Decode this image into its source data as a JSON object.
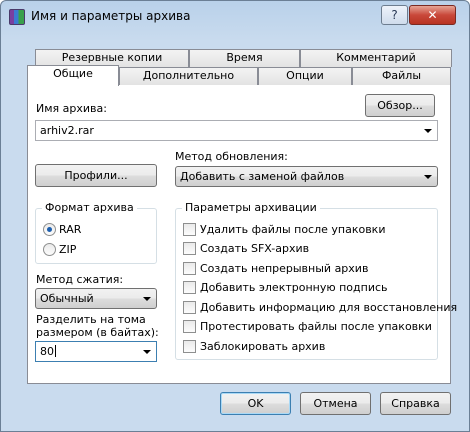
{
  "window": {
    "title": "Имя и параметры архива",
    "help_label": "?",
    "close_label": "✕"
  },
  "tabs": {
    "row_back": [
      "Резервные копии",
      "Время",
      "Комментарий"
    ],
    "row_front": [
      "Общие",
      "Дополнительно",
      "Опции",
      "Файлы"
    ],
    "active": "Общие"
  },
  "general": {
    "archive_name_label": "Имя архива:",
    "archive_name_value": "arhiv2.rar",
    "browse_label": "Обзор...",
    "profiles_label": "Профили...",
    "update_method_label": "Метод обновления:",
    "update_method_value": "Добавить с заменой файлов",
    "format": {
      "title": "Формат архива",
      "options": [
        "RAR",
        "ZIP"
      ],
      "selected": "RAR"
    },
    "compression_label": "Метод сжатия:",
    "compression_value": "Обычный",
    "split_label_line1": "Разделить на тома",
    "split_label_line2": "размером (в байтах):",
    "split_value": "80",
    "params": {
      "title": "Параметры архивации",
      "options": [
        {
          "label": "Удалить файлы после упаковки",
          "checked": false
        },
        {
          "label": "Создать SFX-архив",
          "checked": false
        },
        {
          "label": "Создать непрерывный архив",
          "checked": false
        },
        {
          "label": "Добавить электронную подпись",
          "checked": false
        },
        {
          "label": "Добавить информацию для восстановления",
          "checked": false
        },
        {
          "label": "Протестировать файлы после упаковки",
          "checked": false
        },
        {
          "label": "Заблокировать архив",
          "checked": false
        }
      ]
    }
  },
  "footer": {
    "ok_label": "OK",
    "cancel_label": "Отмена",
    "help_label": "Справка"
  },
  "colors": {
    "titlebar": "#c9dbee",
    "close": "#c9483a",
    "radio_dot": "#1d5fae"
  }
}
